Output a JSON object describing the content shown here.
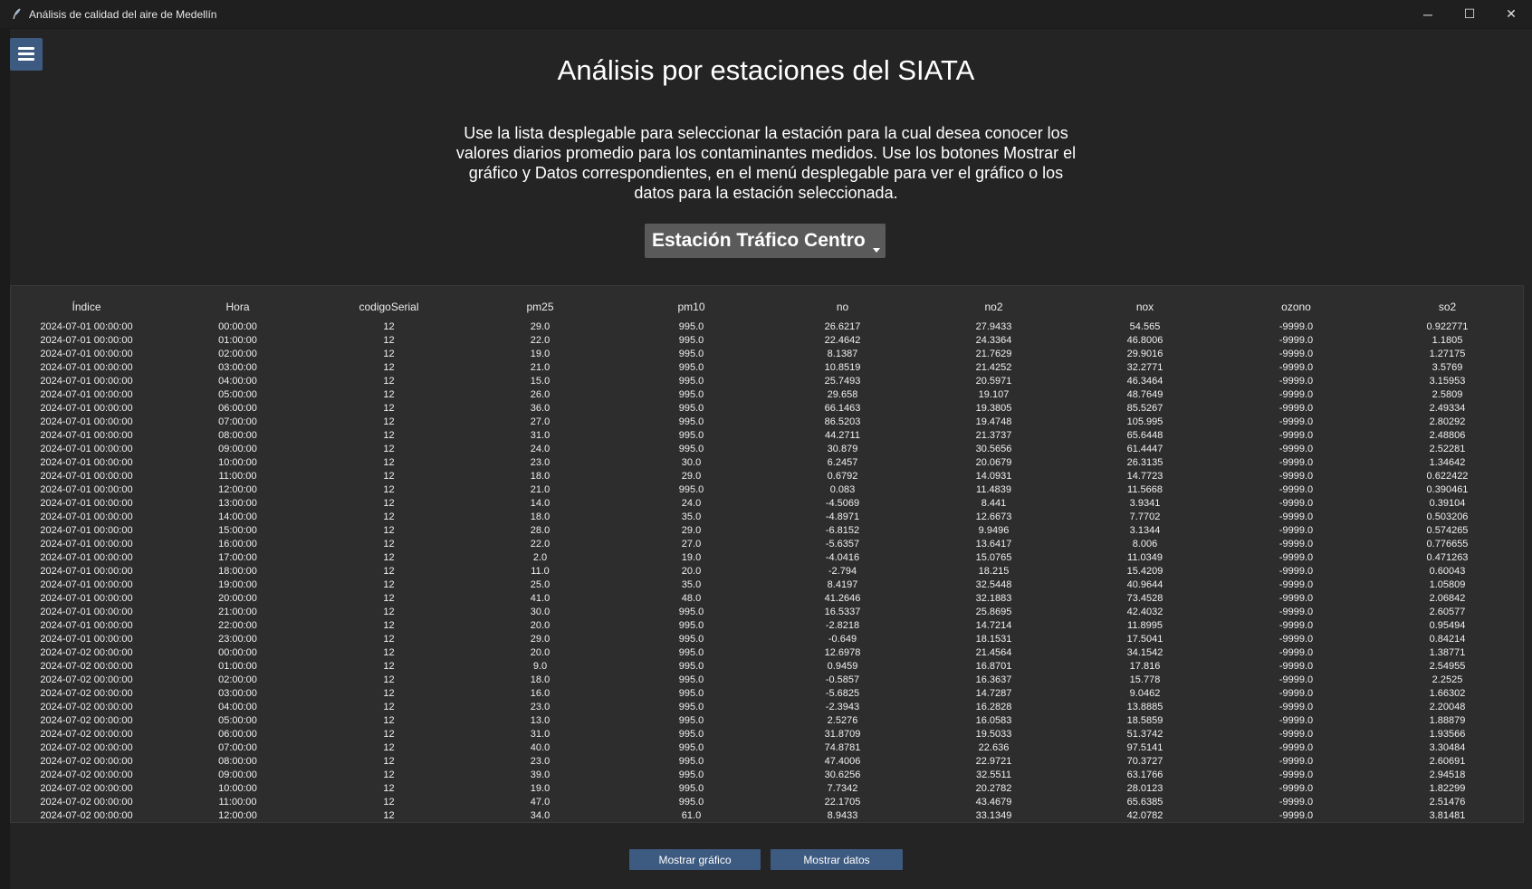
{
  "window": {
    "title": "Análisis de calidad del aire de Medellín",
    "controls": {
      "minimize": "─",
      "maximize": "☐",
      "close": "✕"
    }
  },
  "menu_icon": "hamburger-menu-icon",
  "header": {
    "title": "Análisis por estaciones del SIATA",
    "description": "Use la lista desplegable para seleccionar la estación para la cual desea conocer los valores diarios promedio para los contaminantes medidos. Use los botones Mostrar el gráfico y Datos correspondientes, en el menú desplegable para ver el gráfico o los datos para la estación seleccionada."
  },
  "station_select": {
    "value": "Estación Tráfico Centro"
  },
  "table": {
    "columns": [
      "Índice",
      "Hora",
      "codigoSerial",
      "pm25",
      "pm10",
      "no",
      "no2",
      "nox",
      "ozono",
      "so2"
    ],
    "rows": [
      [
        "2024-07-01 00:00:00",
        "00:00:00",
        "12",
        "29.0",
        "995.0",
        "26.6217",
        "27.9433",
        "54.565",
        "-9999.0",
        "0.922771"
      ],
      [
        "2024-07-01 00:00:00",
        "01:00:00",
        "12",
        "22.0",
        "995.0",
        "22.4642",
        "24.3364",
        "46.8006",
        "-9999.0",
        "1.1805"
      ],
      [
        "2024-07-01 00:00:00",
        "02:00:00",
        "12",
        "19.0",
        "995.0",
        "8.1387",
        "21.7629",
        "29.9016",
        "-9999.0",
        "1.27175"
      ],
      [
        "2024-07-01 00:00:00",
        "03:00:00",
        "12",
        "21.0",
        "995.0",
        "10.8519",
        "21.4252",
        "32.2771",
        "-9999.0",
        "3.5769"
      ],
      [
        "2024-07-01 00:00:00",
        "04:00:00",
        "12",
        "15.0",
        "995.0",
        "25.7493",
        "20.5971",
        "46.3464",
        "-9999.0",
        "3.15953"
      ],
      [
        "2024-07-01 00:00:00",
        "05:00:00",
        "12",
        "26.0",
        "995.0",
        "29.658",
        "19.107",
        "48.7649",
        "-9999.0",
        "2.5809"
      ],
      [
        "2024-07-01 00:00:00",
        "06:00:00",
        "12",
        "36.0",
        "995.0",
        "66.1463",
        "19.3805",
        "85.5267",
        "-9999.0",
        "2.49334"
      ],
      [
        "2024-07-01 00:00:00",
        "07:00:00",
        "12",
        "27.0",
        "995.0",
        "86.5203",
        "19.4748",
        "105.995",
        "-9999.0",
        "2.80292"
      ],
      [
        "2024-07-01 00:00:00",
        "08:00:00",
        "12",
        "31.0",
        "995.0",
        "44.2711",
        "21.3737",
        "65.6448",
        "-9999.0",
        "2.48806"
      ],
      [
        "2024-07-01 00:00:00",
        "09:00:00",
        "12",
        "24.0",
        "995.0",
        "30.879",
        "30.5656",
        "61.4447",
        "-9999.0",
        "2.52281"
      ],
      [
        "2024-07-01 00:00:00",
        "10:00:00",
        "12",
        "23.0",
        "30.0",
        "6.2457",
        "20.0679",
        "26.3135",
        "-9999.0",
        "1.34642"
      ],
      [
        "2024-07-01 00:00:00",
        "11:00:00",
        "12",
        "18.0",
        "29.0",
        "0.6792",
        "14.0931",
        "14.7723",
        "-9999.0",
        "0.622422"
      ],
      [
        "2024-07-01 00:00:00",
        "12:00:00",
        "12",
        "21.0",
        "995.0",
        "0.083",
        "11.4839",
        "11.5668",
        "-9999.0",
        "0.390461"
      ],
      [
        "2024-07-01 00:00:00",
        "13:00:00",
        "12",
        "14.0",
        "24.0",
        "-4.5069",
        "8.441",
        "3.9341",
        "-9999.0",
        "0.39104"
      ],
      [
        "2024-07-01 00:00:00",
        "14:00:00",
        "12",
        "18.0",
        "35.0",
        "-4.8971",
        "12.6673",
        "7.7702",
        "-9999.0",
        "0.503206"
      ],
      [
        "2024-07-01 00:00:00",
        "15:00:00",
        "12",
        "28.0",
        "29.0",
        "-6.8152",
        "9.9496",
        "3.1344",
        "-9999.0",
        "0.574265"
      ],
      [
        "2024-07-01 00:00:00",
        "16:00:00",
        "12",
        "22.0",
        "27.0",
        "-5.6357",
        "13.6417",
        "8.006",
        "-9999.0",
        "0.776655"
      ],
      [
        "2024-07-01 00:00:00",
        "17:00:00",
        "12",
        "2.0",
        "19.0",
        "-4.0416",
        "15.0765",
        "11.0349",
        "-9999.0",
        "0.471263"
      ],
      [
        "2024-07-01 00:00:00",
        "18:00:00",
        "12",
        "11.0",
        "20.0",
        "-2.794",
        "18.215",
        "15.4209",
        "-9999.0",
        "0.60043"
      ],
      [
        "2024-07-01 00:00:00",
        "19:00:00",
        "12",
        "25.0",
        "35.0",
        "8.4197",
        "32.5448",
        "40.9644",
        "-9999.0",
        "1.05809"
      ],
      [
        "2024-07-01 00:00:00",
        "20:00:00",
        "12",
        "41.0",
        "48.0",
        "41.2646",
        "32.1883",
        "73.4528",
        "-9999.0",
        "2.06842"
      ],
      [
        "2024-07-01 00:00:00",
        "21:00:00",
        "12",
        "30.0",
        "995.0",
        "16.5337",
        "25.8695",
        "42.4032",
        "-9999.0",
        "2.60577"
      ],
      [
        "2024-07-01 00:00:00",
        "22:00:00",
        "12",
        "20.0",
        "995.0",
        "-2.8218",
        "14.7214",
        "11.8995",
        "-9999.0",
        "0.95494"
      ],
      [
        "2024-07-01 00:00:00",
        "23:00:00",
        "12",
        "29.0",
        "995.0",
        "-0.649",
        "18.1531",
        "17.5041",
        "-9999.0",
        "0.84214"
      ],
      [
        "2024-07-02 00:00:00",
        "00:00:00",
        "12",
        "20.0",
        "995.0",
        "12.6978",
        "21.4564",
        "34.1542",
        "-9999.0",
        "1.38771"
      ],
      [
        "2024-07-02 00:00:00",
        "01:00:00",
        "12",
        "9.0",
        "995.0",
        "0.9459",
        "16.8701",
        "17.816",
        "-9999.0",
        "2.54955"
      ],
      [
        "2024-07-02 00:00:00",
        "02:00:00",
        "12",
        "18.0",
        "995.0",
        "-0.5857",
        "16.3637",
        "15.778",
        "-9999.0",
        "2.2525"
      ],
      [
        "2024-07-02 00:00:00",
        "03:00:00",
        "12",
        "16.0",
        "995.0",
        "-5.6825",
        "14.7287",
        "9.0462",
        "-9999.0",
        "1.66302"
      ],
      [
        "2024-07-02 00:00:00",
        "04:00:00",
        "12",
        "23.0",
        "995.0",
        "-2.3943",
        "16.2828",
        "13.8885",
        "-9999.0",
        "2.20048"
      ],
      [
        "2024-07-02 00:00:00",
        "05:00:00",
        "12",
        "13.0",
        "995.0",
        "2.5276",
        "16.0583",
        "18.5859",
        "-9999.0",
        "1.88879"
      ],
      [
        "2024-07-02 00:00:00",
        "06:00:00",
        "12",
        "31.0",
        "995.0",
        "31.8709",
        "19.5033",
        "51.3742",
        "-9999.0",
        "1.93566"
      ],
      [
        "2024-07-02 00:00:00",
        "07:00:00",
        "12",
        "40.0",
        "995.0",
        "74.8781",
        "22.636",
        "97.5141",
        "-9999.0",
        "3.30484"
      ],
      [
        "2024-07-02 00:00:00",
        "08:00:00",
        "12",
        "23.0",
        "995.0",
        "47.4006",
        "22.9721",
        "70.3727",
        "-9999.0",
        "2.60691"
      ],
      [
        "2024-07-02 00:00:00",
        "09:00:00",
        "12",
        "39.0",
        "995.0",
        "30.6256",
        "32.5511",
        "63.1766",
        "-9999.0",
        "2.94518"
      ],
      [
        "2024-07-02 00:00:00",
        "10:00:00",
        "12",
        "19.0",
        "995.0",
        "7.7342",
        "20.2782",
        "28.0123",
        "-9999.0",
        "1.82299"
      ],
      [
        "2024-07-02 00:00:00",
        "11:00:00",
        "12",
        "47.0",
        "995.0",
        "22.1705",
        "43.4679",
        "65.6385",
        "-9999.0",
        "2.51476"
      ],
      [
        "2024-07-02 00:00:00",
        "12:00:00",
        "12",
        "34.0",
        "61.0",
        "8.9433",
        "33.1349",
        "42.0782",
        "-9999.0",
        "3.81481"
      ]
    ]
  },
  "buttons": {
    "show_chart": "Mostrar gráfico",
    "show_data": "Mostrar datos"
  },
  "colors": {
    "accent": "#3d5a80",
    "background": "#242424",
    "table_background": "#2d2d2d",
    "select_background": "#5a5a5a"
  }
}
